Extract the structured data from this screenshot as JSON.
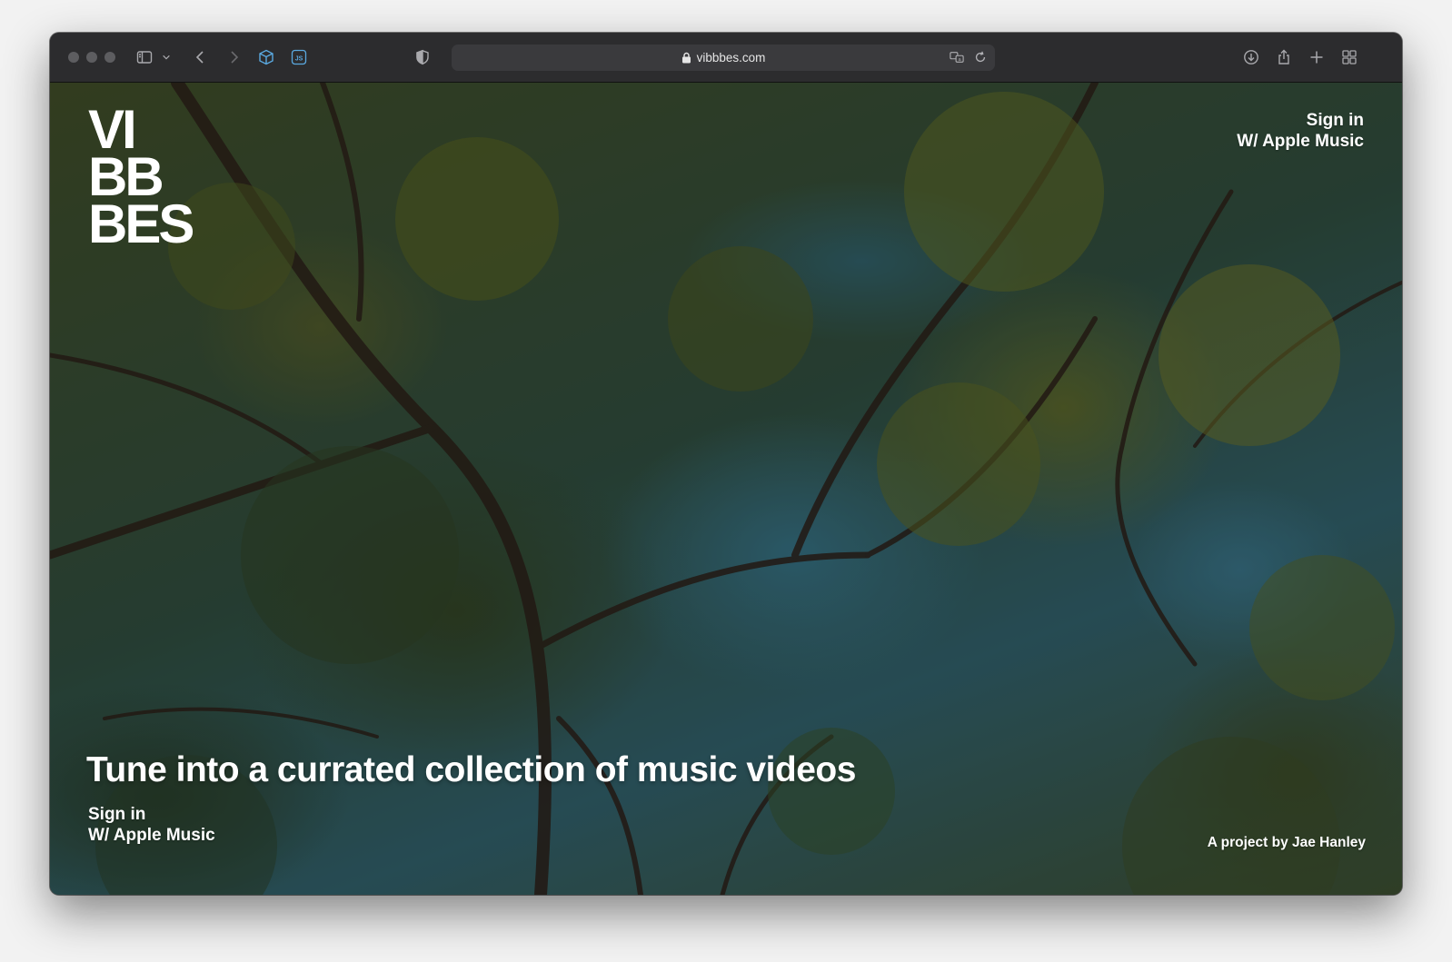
{
  "browser": {
    "url": "vibbbes.com",
    "icons": [
      "sidebar-icon",
      "chevron-down-icon",
      "back-icon",
      "forward-icon",
      "cube-extension-icon",
      "js-extension-icon",
      "privacy-shield-icon",
      "lock-icon",
      "translate-icon",
      "reload-icon",
      "download-icon",
      "share-icon",
      "new-tab-icon",
      "tab-overview-icon"
    ]
  },
  "page": {
    "logo_lines": [
      "VI",
      "BB",
      "BES"
    ],
    "signin_top": {
      "line1": "Sign in",
      "line2": "W/ Apple Music"
    },
    "headline": "Tune into a currated collection of music videos",
    "signin_bottom": {
      "line1": "Sign in",
      "line2": "W/ Apple Music"
    },
    "credit": "A project by Jae Hanley"
  },
  "colors": {
    "text": "#ffffff",
    "toolbar": "#2c2c2e",
    "addressbar": "#3a3a3d"
  }
}
